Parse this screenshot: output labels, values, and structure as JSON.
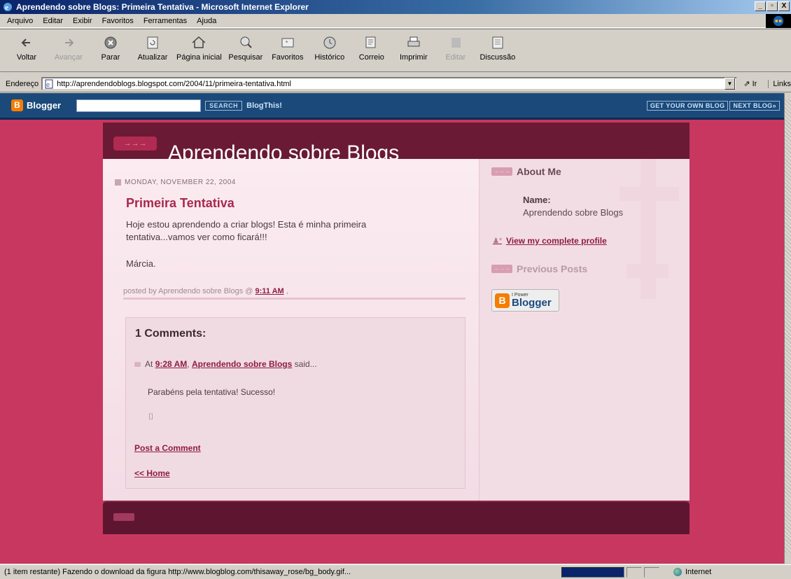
{
  "window": {
    "title": "Aprendendo sobre Blogs: Primeira Tentativa - Microsoft Internet Explorer",
    "min": "_",
    "max": "▫",
    "close": "X"
  },
  "menu": [
    "Arquivo",
    "Editar",
    "Exibir",
    "Favoritos",
    "Ferramentas",
    "Ajuda"
  ],
  "toolbar": {
    "back": "Voltar",
    "forward": "Avançar",
    "stop": "Parar",
    "refresh": "Atualizar",
    "home": "Página inicial",
    "search": "Pesquisar",
    "favorites": "Favoritos",
    "history": "Histórico",
    "mail": "Correio",
    "print": "Imprimir",
    "edit": "Editar",
    "discuss": "Discussão"
  },
  "address": {
    "label": "Endereço",
    "url": "http://aprendendoblogs.blogspot.com/2004/11/primeira-tentativa.html",
    "go": "Ir",
    "links": "Links"
  },
  "navbar": {
    "brand": "Blogger",
    "search_button": "SEARCH",
    "blogthis": "BlogThis!",
    "get_own_blog": "GET YOUR OWN BLOG",
    "next_blog": "NEXT BLOG»"
  },
  "blog": {
    "title": "Aprendendo sobre Blogs",
    "date": "MONDAY, NOVEMBER 22, 2004",
    "post_title": "Primeira Tentativa",
    "post_body": "Hoje estou aprendendo a criar blogs! Esta é minha primeira tentativa...vamos ver como ficará!!!",
    "post_sign": "Márcia.",
    "posted_by": "posted by Aprendendo sobre Blogs @",
    "posted_time": "9:11 AM",
    "posted_sep": ",",
    "comments_heading": "1 Comments:",
    "comment_at": "At",
    "comment_time": "9:28 AM",
    "comment_sep": ",",
    "comment_author": "Aprendendo sobre Blogs",
    "comment_said": "said...",
    "comment_text": "Parabéns pela tentativa! Sucesso!",
    "comment_trash": "⌷",
    "post_comment": "Post a Comment",
    "home": "<< Home"
  },
  "sidebar": {
    "about_heading": "About Me",
    "name_label": "Name:",
    "name_value": "Aprendendo sobre Blogs",
    "profile_link": "View my complete profile",
    "previous_heading": "Previous Posts",
    "powered_small": "I Power",
    "powered_brand": "Blogger"
  },
  "status": {
    "text": "(1 item restante) Fazendo o download da figura http://www.blogblog.com/thisaway_rose/bg_body.gif...",
    "zone": "Internet"
  }
}
